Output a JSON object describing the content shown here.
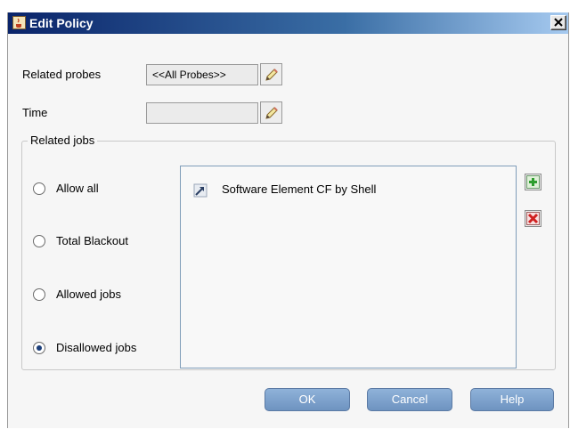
{
  "window": {
    "title": "Edit Policy",
    "title_icon": "java-cup-icon",
    "close_icon": "close-icon"
  },
  "related_probes": {
    "label": "Related probes",
    "value": "<<All Probes>>",
    "edit_icon": "pencil-icon"
  },
  "time": {
    "label": "Time",
    "value": "",
    "edit_icon": "pencil-icon"
  },
  "related_jobs": {
    "title": "Related jobs",
    "options": [
      {
        "label": "Allow all",
        "checked": false
      },
      {
        "label": "Total Blackout",
        "checked": false
      },
      {
        "label": "Allowed jobs",
        "checked": false
      },
      {
        "label": "Disallowed jobs",
        "checked": true
      }
    ],
    "jobs": [
      {
        "label": "Software Element CF by Shell",
        "icon": "job-arrow-icon"
      }
    ],
    "add_icon": "add-plus-icon",
    "remove_icon": "remove-x-icon"
  },
  "buttons": {
    "ok": "OK",
    "cancel": "Cancel",
    "help": "Help"
  },
  "colors": {
    "title_bar": "#0a246a",
    "button": "#7a9cc6",
    "add_green": "#2e9e2e",
    "remove_red": "#d02020"
  }
}
